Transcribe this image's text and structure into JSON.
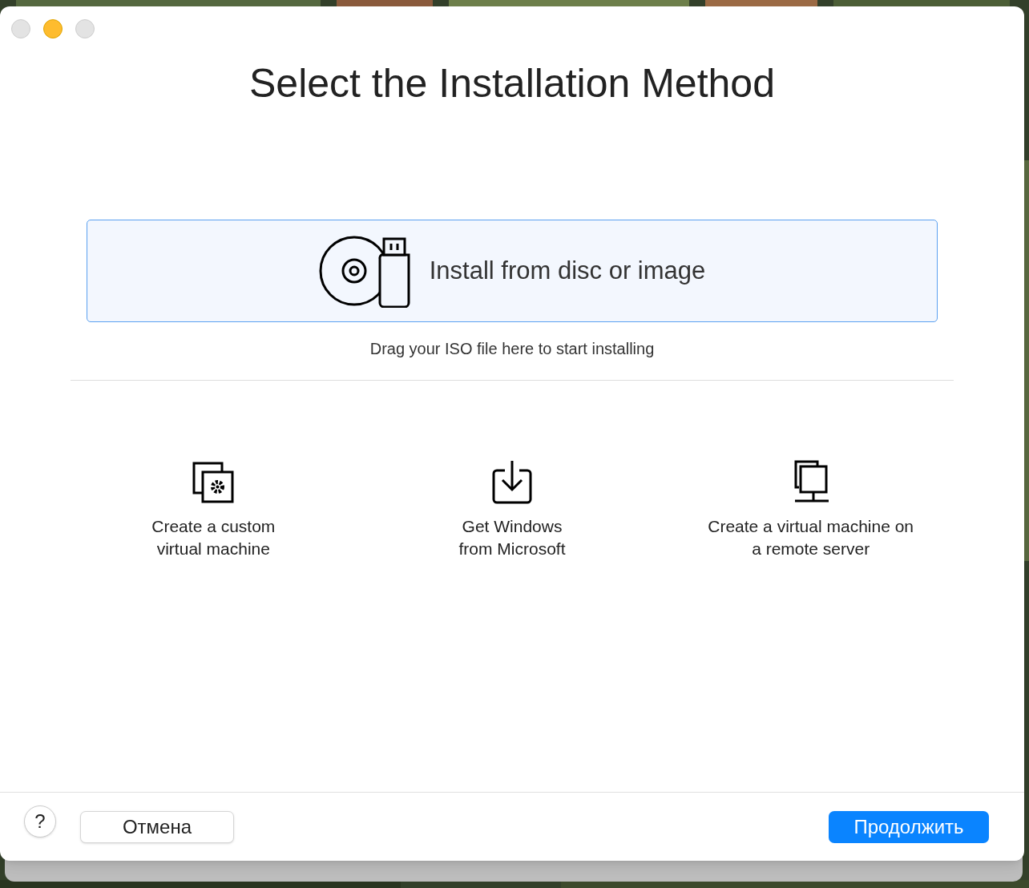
{
  "window": {
    "title": "Select the Installation Method",
    "controls": [
      {
        "disabled": true
      },
      {
        "disabled": false
      },
      {
        "disabled": true
      }
    ]
  },
  "primary_option": {
    "label": "Install from disc or image",
    "selected": true,
    "hint": "Drag your ISO file here to start installing"
  },
  "options": [
    {
      "label": "Create a custom\nvirtual machine",
      "selected": false
    },
    {
      "label": "Get Windows\nfrom Microsoft",
      "selected": false
    },
    {
      "label": "Create a virtual machine on\na remote server",
      "selected": false
    }
  ],
  "footer": {
    "help": "?",
    "cancel": "Отмена",
    "continue": "Продолжить"
  }
}
